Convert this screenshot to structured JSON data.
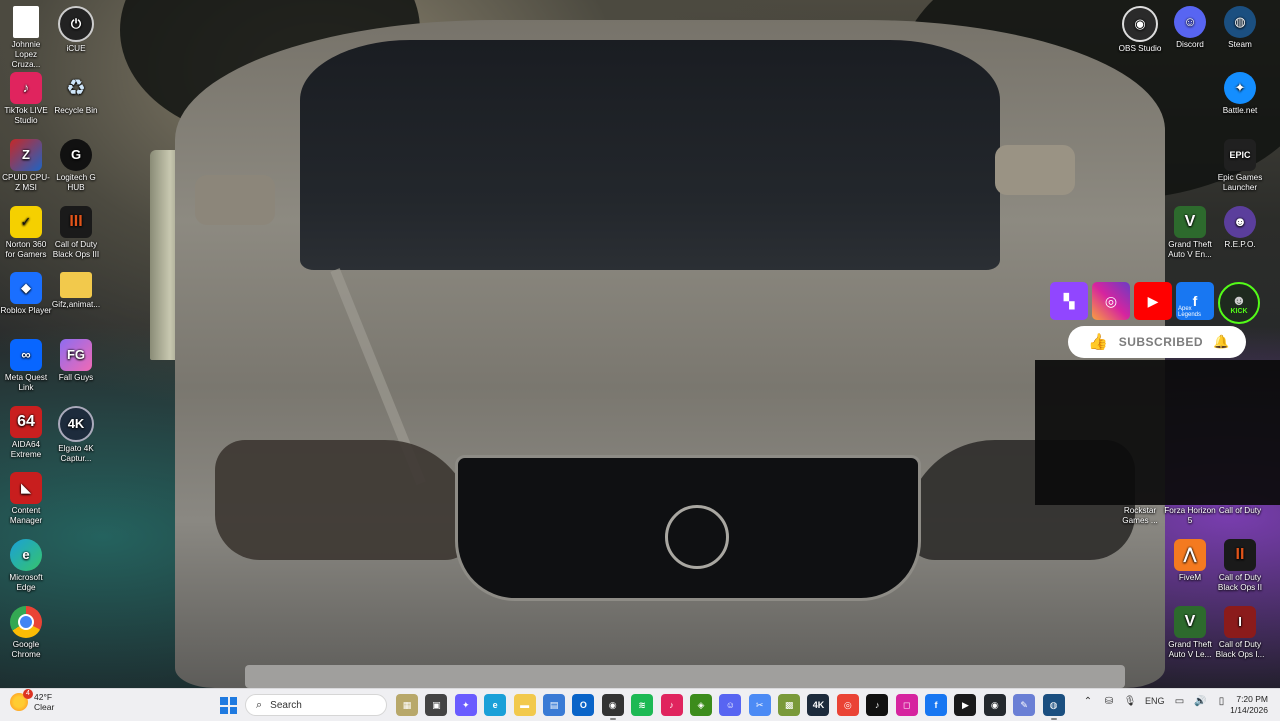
{
  "desktop": {
    "left_icons": [
      {
        "label": "Johnnie Lopez Cruza...",
        "icon": "document-icon",
        "color": "#ffffff"
      },
      {
        "label": "iCUE",
        "icon": "icue-icon",
        "color": "#222222"
      },
      {
        "label": "TikTok LIVE Studio",
        "icon": "tiktok-live-icon",
        "color": "#e0245e"
      },
      {
        "label": "Recycle Bin",
        "icon": "recycle-bin-icon",
        "color": "#8ab4d8"
      },
      {
        "label": "CPUID CPU-Z MSI",
        "icon": "cpuz-icon",
        "color": "#c62828"
      },
      {
        "label": "Logitech G HUB",
        "icon": "logitech-icon",
        "color": "#111111"
      },
      {
        "label": "Norton 360 for Gamers",
        "icon": "norton-icon",
        "color": "#f5d000"
      },
      {
        "label": "Call of Duty Black Ops III",
        "icon": "bo3-icon",
        "color": "#d6541a"
      },
      {
        "label": "Roblox Player",
        "icon": "roblox-icon",
        "color": "#1a6fff"
      },
      {
        "label": "Gifz,animat...",
        "icon": "folder-icon",
        "color": "#f2c94c"
      },
      {
        "label": "Meta Quest Link",
        "icon": "meta-icon",
        "color": "#0866ff"
      },
      {
        "label": "Fall Guys",
        "icon": "fall-guys-icon",
        "color": "#8e6cf0"
      },
      {
        "label": "AIDA64 Extreme",
        "icon": "aida64-icon",
        "color": "#c91f1f"
      },
      {
        "label": "Elgato 4K Captur...",
        "icon": "elgato-icon",
        "color": "#1d2b3c"
      },
      {
        "label": "Content Manager",
        "icon": "content-manager-icon",
        "color": "#c81e1e"
      },
      {
        "label": "Microsoft Edge",
        "icon": "edge-icon",
        "color": "#1aa0d8"
      },
      {
        "label": "Google Chrome",
        "icon": "chrome-icon",
        "color": "#ea4335"
      }
    ],
    "right_icons": [
      {
        "label": "OBS Studio",
        "icon": "obs-icon",
        "color": "#2a2a2a"
      },
      {
        "label": "Discord",
        "icon": "discord-icon",
        "color": "#5865f2"
      },
      {
        "label": "Steam",
        "icon": "steam-icon",
        "color": "#1b4f80"
      },
      {
        "label": "Battle.net",
        "icon": "battlenet-icon",
        "color": "#148eff"
      },
      {
        "label": "Epic Games Launcher",
        "icon": "epic-icon",
        "color": "#202020"
      },
      {
        "label": "Grand Theft Auto V En...",
        "icon": "gta-icon",
        "color": "#2d6a2d"
      },
      {
        "label": "R.E.P.O.",
        "icon": "repo-icon",
        "color": "#5b3e9c"
      },
      {
        "label": "Rockstar Games ...",
        "icon": "rockstar-icon",
        "color": "#e8a317"
      },
      {
        "label": "Forza Horizon 5",
        "icon": "forza-icon",
        "color": "#7b2fbf"
      },
      {
        "label": "Call of Duty",
        "icon": "cod-icon",
        "color": "#333333"
      },
      {
        "label": "FiveM",
        "icon": "fivem-icon",
        "color": "#f47a20"
      },
      {
        "label": "Call of Duty Black Ops II",
        "icon": "bo2-icon",
        "color": "#d6541a"
      },
      {
        "label": "Grand Theft Auto V Le...",
        "icon": "gta-legacy-icon",
        "color": "#2d6a2d"
      },
      {
        "label": "Call of Duty Black Ops I...",
        "icon": "bo-icon",
        "color": "#8b1b1b"
      }
    ],
    "apex_label": "Apex Legends"
  },
  "overlay": {
    "social": [
      {
        "name": "twitch-icon",
        "color": "#9146ff"
      },
      {
        "name": "instagram-icon",
        "color": "#d6249f"
      },
      {
        "name": "youtube-icon",
        "color": "#ff0000"
      },
      {
        "name": "facebook-icon",
        "color": "#1877f2"
      },
      {
        "name": "kick-avatar-icon",
        "color": "#1e2a1e"
      }
    ],
    "subscribed_label": "SUBSCRIBED",
    "kick_label": "KICK"
  },
  "taskbar": {
    "weather_temp": "42°F",
    "weather_desc": "Clear",
    "weather_badge": "4",
    "search_placeholder": "Search",
    "apps": [
      {
        "name": "taskbar-sandbox-icon",
        "color": "#b8a86a",
        "glyph": "▦"
      },
      {
        "name": "taskbar-task-view-icon",
        "color": "#444444",
        "glyph": "▣"
      },
      {
        "name": "taskbar-copilot-icon",
        "color": "#6a5cff",
        "glyph": "✦"
      },
      {
        "name": "taskbar-edge-icon",
        "color": "#1aa0d8",
        "glyph": "e"
      },
      {
        "name": "taskbar-file-explorer-icon",
        "color": "#f2c94c",
        "glyph": "▬"
      },
      {
        "name": "taskbar-store-icon",
        "color": "#3a7bd5",
        "glyph": "▤"
      },
      {
        "name": "taskbar-outlook-icon",
        "color": "#0a64c8",
        "glyph": "O"
      },
      {
        "name": "taskbar-obs-icon",
        "color": "#333333",
        "glyph": "◉"
      },
      {
        "name": "taskbar-spotify-icon",
        "color": "#1db954",
        "glyph": "≋"
      },
      {
        "name": "taskbar-tiktok-icon",
        "color": "#e0245e",
        "glyph": "♪"
      },
      {
        "name": "taskbar-nvidia-icon",
        "color": "#3c8c1c",
        "glyph": "◈"
      },
      {
        "name": "taskbar-discord-icon",
        "color": "#5865f2",
        "glyph": "☺"
      },
      {
        "name": "taskbar-snipping-icon",
        "color": "#4c8bf5",
        "glyph": "✂"
      },
      {
        "name": "taskbar-minecraft-icon",
        "color": "#7a9a3a",
        "glyph": "▩"
      },
      {
        "name": "taskbar-elgato-icon",
        "color": "#1d2b3c",
        "glyph": "4K"
      },
      {
        "name": "taskbar-chrome-icon",
        "color": "#ea4335",
        "glyph": "◎"
      },
      {
        "name": "taskbar-tiktok2-icon",
        "color": "#111111",
        "glyph": "♪"
      },
      {
        "name": "taskbar-instagram-icon",
        "color": "#d6249f",
        "glyph": "◻"
      },
      {
        "name": "taskbar-facebook-icon",
        "color": "#1877f2",
        "glyph": "f"
      },
      {
        "name": "taskbar-capcut-icon",
        "color": "#1b1b1b",
        "glyph": "▶"
      },
      {
        "name": "taskbar-github-icon",
        "color": "#24292e",
        "glyph": "◉"
      },
      {
        "name": "taskbar-notepad-icon",
        "color": "#6a7fd5",
        "glyph": "✎"
      },
      {
        "name": "taskbar-steam-icon",
        "color": "#1b4f80",
        "glyph": "◍"
      }
    ],
    "language": "ENG",
    "time": "7:20 PM",
    "date": "1/14/2026"
  }
}
